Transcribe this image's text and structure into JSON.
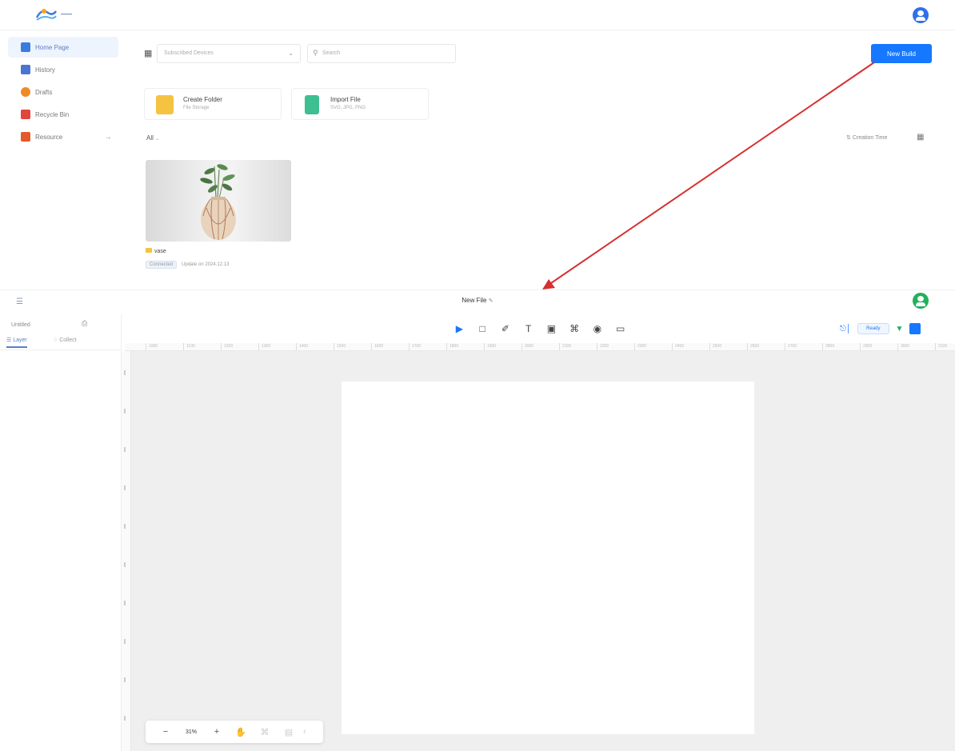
{
  "home": {
    "sidebar": {
      "items": [
        {
          "label": "Home Page",
          "icon": "home-icon",
          "color": "#3a7be0"
        },
        {
          "label": "History",
          "icon": "history-icon",
          "color": "#4a74d0"
        },
        {
          "label": "Drafts",
          "icon": "drafts-icon",
          "color": "#f08a24"
        },
        {
          "label": "Recycle Bin",
          "icon": "recycle-bin-icon",
          "color": "#e0463a"
        },
        {
          "label": "Resource",
          "icon": "resource-icon",
          "color": "#e55a2c"
        }
      ]
    },
    "filters": {
      "device_placeholder": "Subscribed Devices",
      "search_placeholder": "Search"
    },
    "new_build_label": "New Build",
    "quick_actions": [
      {
        "title": "Create Folder",
        "subtitle": "File Storage"
      },
      {
        "title": "Import File",
        "subtitle": "SVG, JPG, PNG"
      }
    ],
    "all_filter": "All",
    "sort_label": "Creation Time",
    "project": {
      "name": "vase",
      "tag": "Connected",
      "updated": "Update on 2024.12.13"
    }
  },
  "editor": {
    "file_title": "New File",
    "panel_input": "Untitled",
    "tabs": {
      "layer": "Layer",
      "collect": "Collect"
    },
    "mode_label": "Ready",
    "ruler_ticks": [
      "1000",
      "1100",
      "1200",
      "1300",
      "1400",
      "1500",
      "1600",
      "1700",
      "1800",
      "1900",
      "2000",
      "2100",
      "2200",
      "2300",
      "2400",
      "2500",
      "2600",
      "2700",
      "2800",
      "2900",
      "3000",
      "3100",
      "3200"
    ],
    "zoom": {
      "level": "31%"
    }
  },
  "colors": {
    "primary": "#1677ff",
    "annotation_arrow": "#d63031",
    "folder": "#f5c242",
    "import": "#3dbf8f"
  }
}
